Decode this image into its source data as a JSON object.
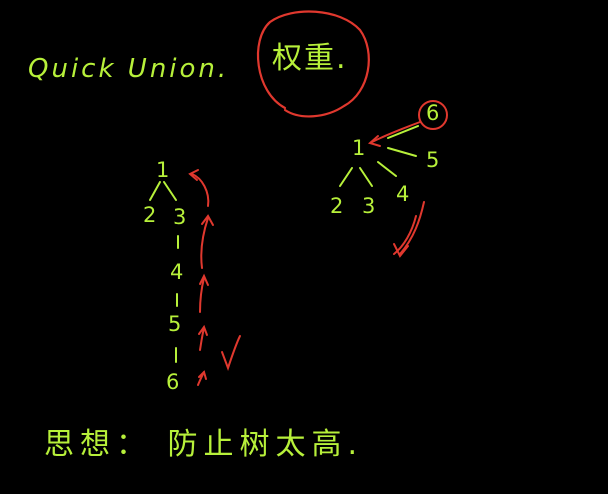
{
  "colors": {
    "background": "#000000",
    "chalk_green": "#b7f03a",
    "ink_red": "#e0382e"
  },
  "header": {
    "title": "Quick Union.",
    "weight_note": "权重."
  },
  "left_tree": {
    "nodes": [
      "1",
      "2",
      "3",
      "4",
      "5",
      "6"
    ]
  },
  "right_tree": {
    "nodes": [
      "1",
      "2",
      "3",
      "4",
      "5",
      "6"
    ]
  },
  "footer": {
    "idea": "思想： 防止树太高."
  }
}
